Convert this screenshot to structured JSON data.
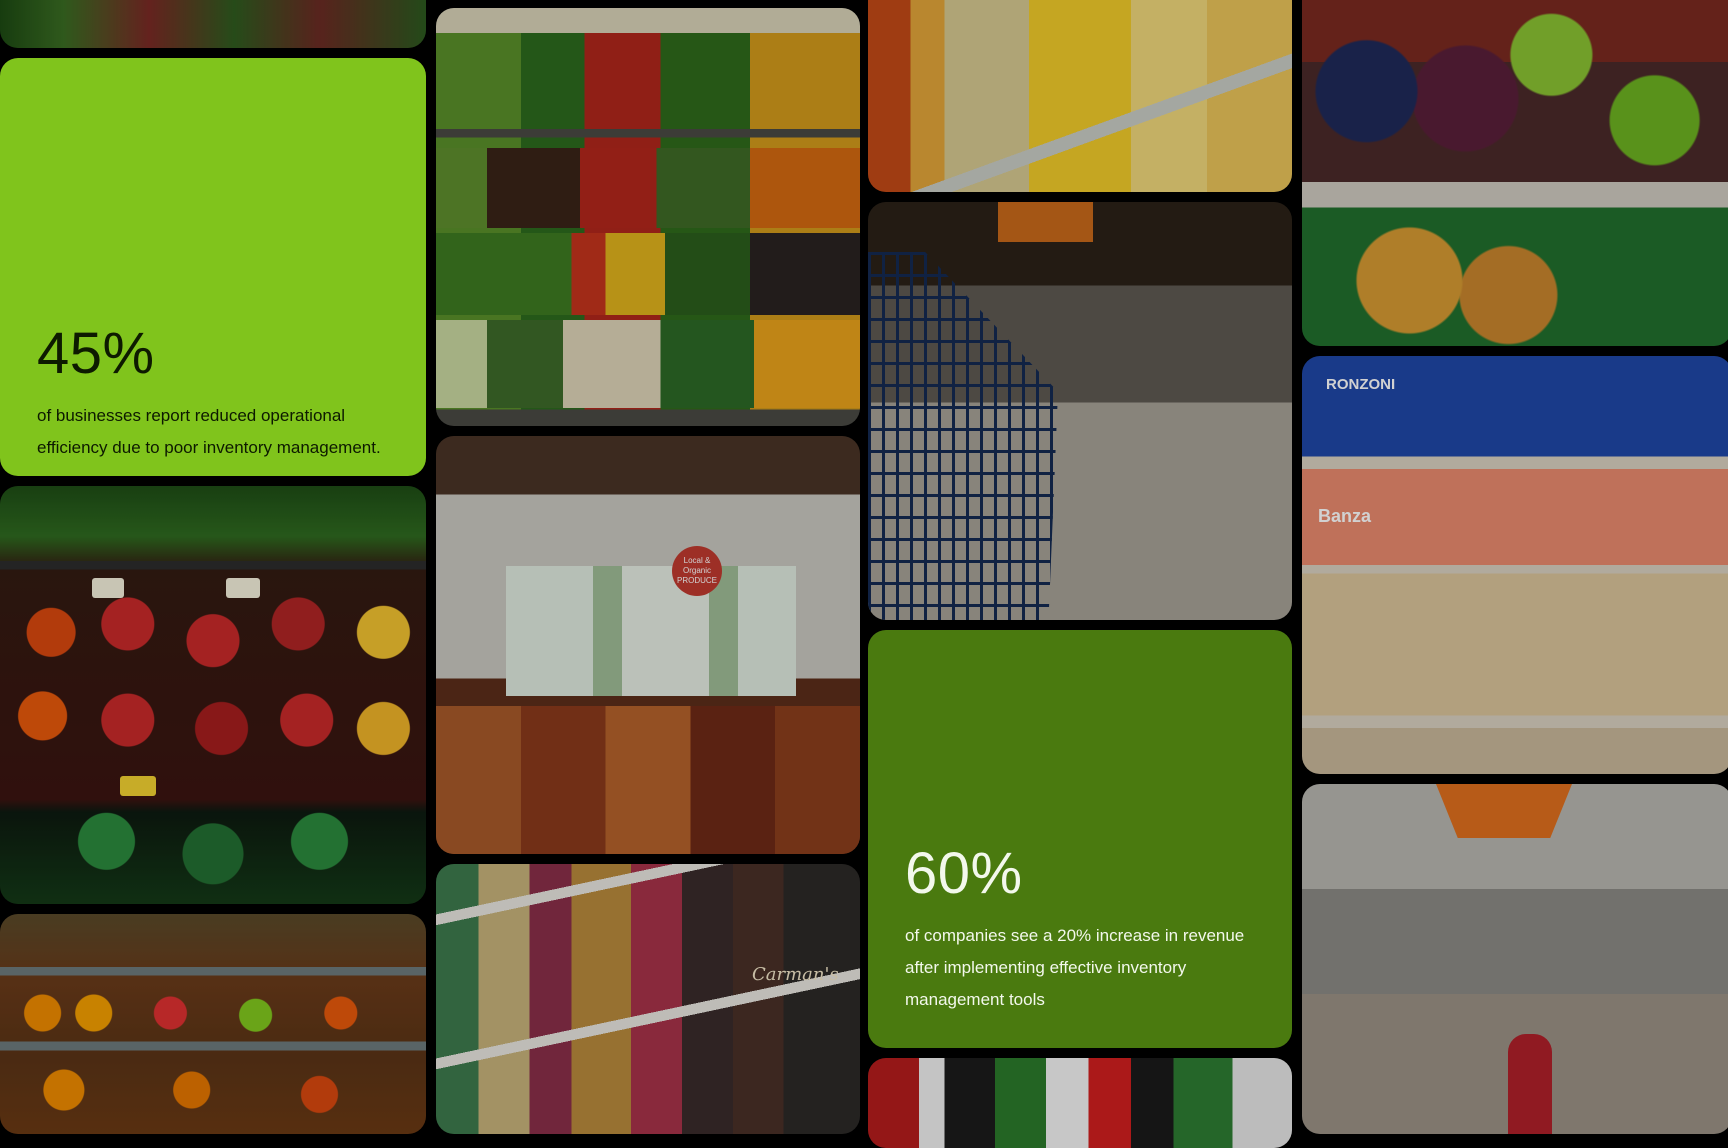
{
  "stats": [
    {
      "value": "45%",
      "text": "of businesses report reduced operational efficiency due to poor inventory management.",
      "bg": "#80c41c"
    },
    {
      "value": "60%",
      "text": "of companies see a 20% increase in revenue after implementing effective inventory management tools",
      "bg": "#4a7a0f"
    }
  ],
  "photos": {
    "herbs_top": "Fresh herbs and vegetables",
    "vegetable_wall": "Grocery store vegetable wall display",
    "snacks_shelf": "Packaged snacks on shelves",
    "fruit_display": "Fruit display with grapes and peaches",
    "shopping_cart": "Shopping cart in grocery aisle",
    "pasta_shelf": "Pasta boxes on grocery shelves",
    "peppers": "Bell peppers display with price tags",
    "produce_market": "Indoor produce market",
    "citrus_shelves": "Citrus and apple shelves",
    "cereal_shelf": "Cereal boxes on shelves",
    "snack_cans": "Snack cans on shelf",
    "warehouse_aisle": "Warehouse store aisle"
  },
  "sign_labels": {
    "produce_sign": "Local & Organic PRODUCE",
    "pasta_brand": "RONZONI",
    "pasta_brand_2": "Banza",
    "cereal_brand": "Carman's"
  }
}
